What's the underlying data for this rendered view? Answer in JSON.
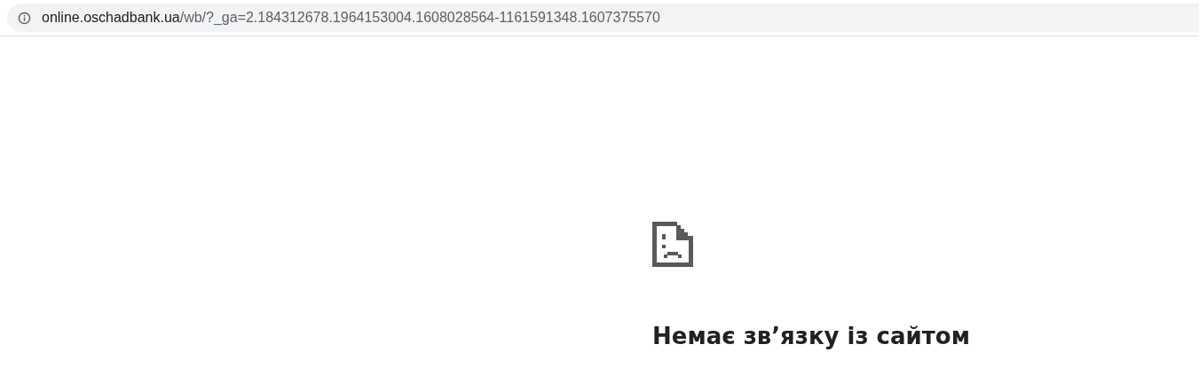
{
  "address_bar": {
    "host": "online.oschadbank.ua",
    "path": "/wb/?_ga=2.184312678.1964153004.1608028564-1161591348.1607375570"
  },
  "error": {
    "heading": "Немає зв’язку із сайтом"
  }
}
